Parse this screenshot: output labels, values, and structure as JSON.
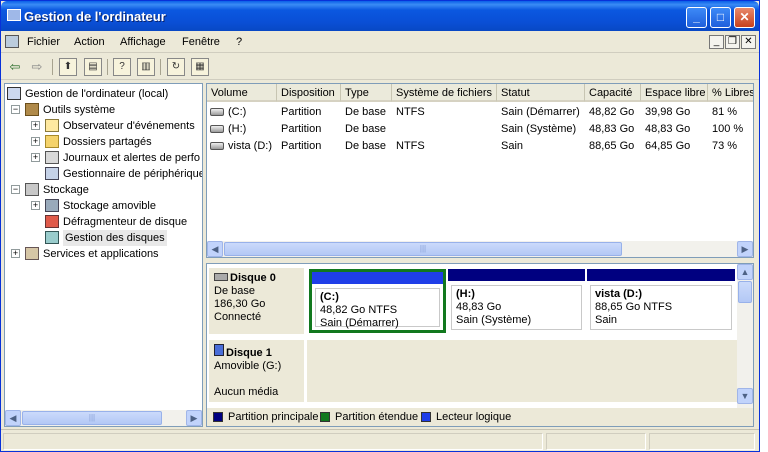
{
  "window": {
    "title": "Gestion de l'ordinateur",
    "controls": {
      "minimize": "_",
      "maximize": "□",
      "close": "✕"
    }
  },
  "menu": {
    "items": [
      "Fichier",
      "Action",
      "Affichage",
      "Fenêtre",
      "?"
    ]
  },
  "toolbar": {
    "back": "⇦",
    "forward": "⇨"
  },
  "tree": {
    "root": "Gestion de l'ordinateur (local)",
    "system_tools": "Outils système",
    "event_viewer": "Observateur d'événements",
    "shared_folders": "Dossiers partagés",
    "perf_logs": "Journaux et alertes de perfo",
    "device_manager": "Gestionnaire de périphérique",
    "storage": "Stockage",
    "removable": "Stockage amovible",
    "defrag": "Défragmenteur de disque",
    "disk_mgmt": "Gestion des disques",
    "services": "Services et applications"
  },
  "volumes": {
    "headers": [
      "Volume",
      "Disposition",
      "Type",
      "Système de fichiers",
      "Statut",
      "Capacité",
      "Espace libre",
      "% Libres"
    ],
    "rows": [
      [
        "(C:)",
        "Partition",
        "De base",
        "NTFS",
        "Sain (Démarrer)",
        "48,82 Go",
        "39,98 Go",
        "81 %"
      ],
      [
        "(H:)",
        "Partition",
        "De base",
        "",
        "Sain (Système)",
        "48,83 Go",
        "48,83 Go",
        "100 %"
      ],
      [
        "vista (D:)",
        "Partition",
        "De base",
        "NTFS",
        "Sain",
        "88,65 Go",
        "64,85 Go",
        "73 %"
      ]
    ]
  },
  "disks": {
    "disk0": {
      "name": "Disque 0",
      "type": "De base",
      "size": "186,30 Go",
      "state": "Connecté"
    },
    "partitions": [
      {
        "name": "(C:)",
        "line2": "48,82 Go NTFS",
        "line3": "Sain (Démarrer)"
      },
      {
        "name": "(H:)",
        "line2": "48,83 Go",
        "line3": "Sain (Système)"
      },
      {
        "name": "vista  (D:)",
        "line2": "88,65 Go NTFS",
        "line3": "Sain"
      }
    ],
    "disk1": {
      "name": "Disque 1",
      "type": "Amovible (G:)",
      "state": "Aucun média"
    }
  },
  "legend": {
    "primary": "Partition principale",
    "extended": "Partition étendue",
    "logical": "Lecteur logique",
    "colors": {
      "primary": "#000080",
      "extended": "#11781e",
      "logical": "#1f3ee8"
    }
  }
}
